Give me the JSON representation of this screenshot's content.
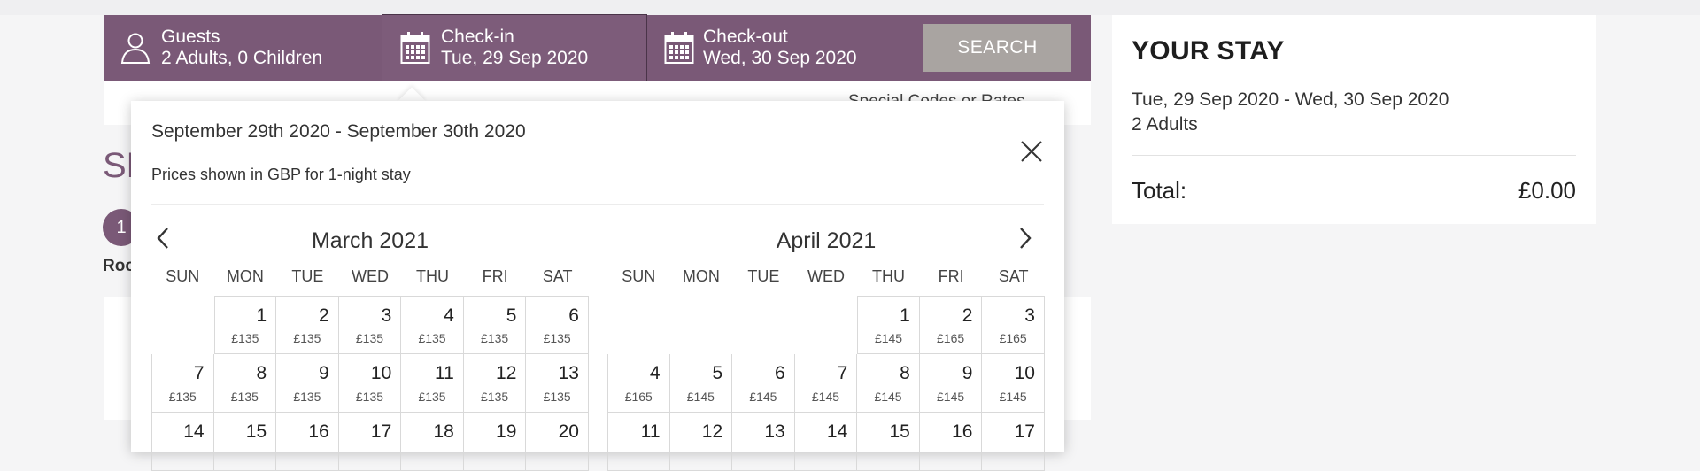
{
  "search": {
    "guests": {
      "label": "Guests",
      "value": "2 Adults, 0 Children",
      "icon": "person-icon"
    },
    "checkin": {
      "label": "Check-in",
      "value": "Tue, 29 Sep 2020",
      "icon": "calendar-icon"
    },
    "checkout": {
      "label": "Check-out",
      "value": "Wed, 30 Sep 2020",
      "icon": "calendar-icon"
    },
    "button": "SEARCH"
  },
  "background": {
    "special_codes": "Special Codes or Rates",
    "heading": "SE",
    "step_number": "1",
    "step_label": "Roo"
  },
  "stay": {
    "title": "YOUR STAY",
    "dates": "Tue, 29 Sep 2020 - Wed, 30 Sep 2020",
    "guests": "2 Adults",
    "total_label": "Total:",
    "total_value": "£0.00"
  },
  "calendar": {
    "range": "September 29th 2020 - September 30th 2020",
    "note": "Prices shown in GBP for 1-night stay",
    "weekdays": [
      "SUN",
      "MON",
      "TUE",
      "WED",
      "THU",
      "FRI",
      "SAT"
    ],
    "months": [
      {
        "title": "March 2021",
        "offset": 1,
        "days": [
          {
            "d": "1",
            "p": "£135"
          },
          {
            "d": "2",
            "p": "£135"
          },
          {
            "d": "3",
            "p": "£135"
          },
          {
            "d": "4",
            "p": "£135"
          },
          {
            "d": "5",
            "p": "£135"
          },
          {
            "d": "6",
            "p": "£135"
          },
          {
            "d": "7",
            "p": "£135"
          },
          {
            "d": "8",
            "p": "£135"
          },
          {
            "d": "9",
            "p": "£135"
          },
          {
            "d": "10",
            "p": "£135"
          },
          {
            "d": "11",
            "p": "£135"
          },
          {
            "d": "12",
            "p": "£135"
          },
          {
            "d": "13",
            "p": "£135"
          },
          {
            "d": "14",
            "p": ""
          },
          {
            "d": "15",
            "p": ""
          },
          {
            "d": "16",
            "p": ""
          },
          {
            "d": "17",
            "p": ""
          },
          {
            "d": "18",
            "p": ""
          },
          {
            "d": "19",
            "p": ""
          },
          {
            "d": "20",
            "p": ""
          }
        ]
      },
      {
        "title": "April 2021",
        "offset": 4,
        "days": [
          {
            "d": "1",
            "p": "£145"
          },
          {
            "d": "2",
            "p": "£165"
          },
          {
            "d": "3",
            "p": "£165"
          },
          {
            "d": "4",
            "p": "£165"
          },
          {
            "d": "5",
            "p": "£145"
          },
          {
            "d": "6",
            "p": "£145"
          },
          {
            "d": "7",
            "p": "£145"
          },
          {
            "d": "8",
            "p": "£145"
          },
          {
            "d": "9",
            "p": "£145"
          },
          {
            "d": "10",
            "p": "£145"
          },
          {
            "d": "11",
            "p": ""
          },
          {
            "d": "12",
            "p": ""
          },
          {
            "d": "13",
            "p": ""
          },
          {
            "d": "14",
            "p": ""
          },
          {
            "d": "15",
            "p": ""
          },
          {
            "d": "16",
            "p": ""
          },
          {
            "d": "17",
            "p": ""
          }
        ]
      }
    ]
  }
}
